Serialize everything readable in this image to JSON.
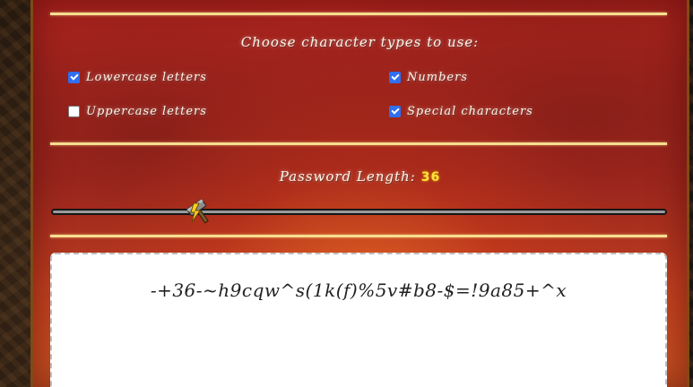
{
  "character_types": {
    "heading": "Choose character types to use:",
    "options": [
      {
        "label": "Lowercase letters",
        "checked": true
      },
      {
        "label": "Uppercase letters",
        "checked": false
      },
      {
        "label": "Numbers",
        "checked": true
      },
      {
        "label": "Special characters",
        "checked": true
      }
    ]
  },
  "length": {
    "label": "Password Length:",
    "value": "36",
    "slider_fraction": 0.24
  },
  "output": {
    "password": "-+36-~h9cqw^s(1k(f)%5v#b8-$=!9a85+^x"
  },
  "icons": {
    "slider_thumb": "hammer-lightning-icon"
  },
  "colors": {
    "panel": "#b0241f",
    "divider": "#f6dd8e",
    "length_value": "#ffe23a",
    "checkbox_checked": "#2f6ff0"
  }
}
